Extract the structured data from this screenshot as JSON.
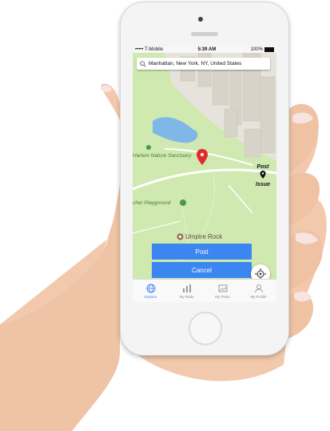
{
  "status_bar": {
    "carrier": "••••• T-Mobile",
    "time": "5:39 AM",
    "battery": "100%"
  },
  "search": {
    "value": "Manhattan, New York, NY, United States"
  },
  "map": {
    "labels": {
      "nature_sanctuary": "Harlem Nature Sanctuary",
      "playground": "cher Playground",
      "umpire_rock": "Umpire Rock"
    },
    "post_issue": {
      "line1": "Post",
      "line2": "Issue"
    },
    "google": [
      "G",
      "o",
      "o",
      "g",
      "l",
      "e"
    ]
  },
  "actions": {
    "post_label": "Post",
    "cancel_label": "Cancel"
  },
  "tabs": [
    {
      "label": "Explore",
      "icon": "globe-icon",
      "active": true
    },
    {
      "label": "My Rads",
      "icon": "bar-chart-icon",
      "active": false
    },
    {
      "label": "My Posts",
      "icon": "photo-icon",
      "active": false
    },
    {
      "label": "My Profile",
      "icon": "person-icon",
      "active": false
    }
  ],
  "colors": {
    "accent": "#3b86f0",
    "pin": "#e32b2b",
    "park_green": "#cfe9b0",
    "water": "#7fb8e8"
  }
}
